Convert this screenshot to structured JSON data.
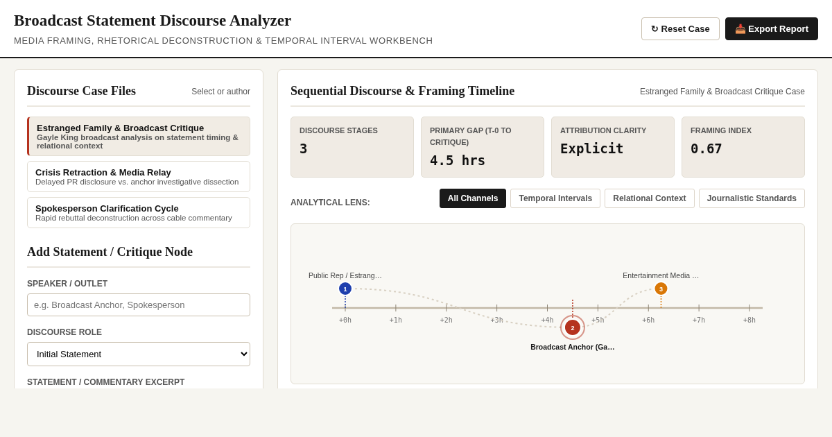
{
  "header": {
    "title": "Broadcast Statement Discourse Analyzer",
    "subtitle": "MEDIA FRAMING, RHETORICAL DECONSTRUCTION & TEMPORAL INTERVAL WORKBENCH",
    "buttons": [
      {
        "kind": "secondary",
        "icon": "↻",
        "label": "Reset Case"
      },
      {
        "kind": "primary",
        "icon": "📥",
        "label": "Export Report"
      }
    ]
  },
  "case_files": {
    "title": "Discourse Case Files",
    "hint": "Select or author",
    "items": [
      {
        "title": "Estranged Family & Broadcast Critique",
        "description": "Gayle King broadcast analysis on statement timing & relational context",
        "selected": true
      },
      {
        "title": "Crisis Retraction & Media Relay",
        "description": "Delayed PR disclosure vs. anchor investigative dissection",
        "selected": false
      },
      {
        "title": "Spokesperson Clarification Cycle",
        "description": "Rapid rebuttal deconstruction across cable commentary",
        "selected": false
      }
    ]
  },
  "form": {
    "title": "Add Statement / Critique Node",
    "fields": [
      {
        "kind": "text",
        "label": "SPEAKER / OUTLET",
        "placeholder": "e.g. Broadcast Anchor, Spokesperson"
      },
      {
        "kind": "select",
        "label": "DISCOURSE ROLE",
        "value": "Initial Statement"
      },
      {
        "kind": "heading",
        "label": "STATEMENT / COMMENTARY EXCERPT"
      }
    ]
  },
  "timeline": {
    "title": "Sequential Discourse & Framing Timeline",
    "case_name": "Estranged Family & Broadcast Critique Case",
    "stats": [
      {
        "label": "DISCOURSE STAGES",
        "value": "3"
      },
      {
        "label": "PRIMARY GAP (T-0 TO CRITIQUE)",
        "value": "4.5 hrs"
      },
      {
        "label": "ATTRIBUTION CLARITY",
        "value": "Explicit"
      },
      {
        "label": "FRAMING INDEX",
        "value": "0.67"
      }
    ],
    "lens_label": "ANALYTICAL LENS:",
    "lenses": [
      {
        "label": "All Channels",
        "selected": true
      },
      {
        "label": "Temporal Intervals",
        "selected": false
      },
      {
        "label": "Relational Context",
        "selected": false
      },
      {
        "label": "Journalistic Standards",
        "selected": false
      }
    ],
    "ticks": [
      "+0h",
      "+1h",
      "+2h",
      "+3h",
      "+4h",
      "+5h",
      "+6h",
      "+7h",
      "+8h"
    ],
    "nodes": [
      {
        "number": "1",
        "label": "Public Rep / Estrang…",
        "kind": "statement",
        "color": "#1e3fae",
        "selected": false,
        "level": 0
      },
      {
        "number": "2",
        "label": "Broadcast Anchor (Ga…",
        "kind": "critique",
        "color": "#b5321e",
        "selected": true,
        "level": 0.5625
      },
      {
        "number": "3",
        "label": "Entertainment Media …",
        "kind": "statement",
        "color": "#d97706",
        "selected": false,
        "level": 0.78125
      }
    ]
  }
}
